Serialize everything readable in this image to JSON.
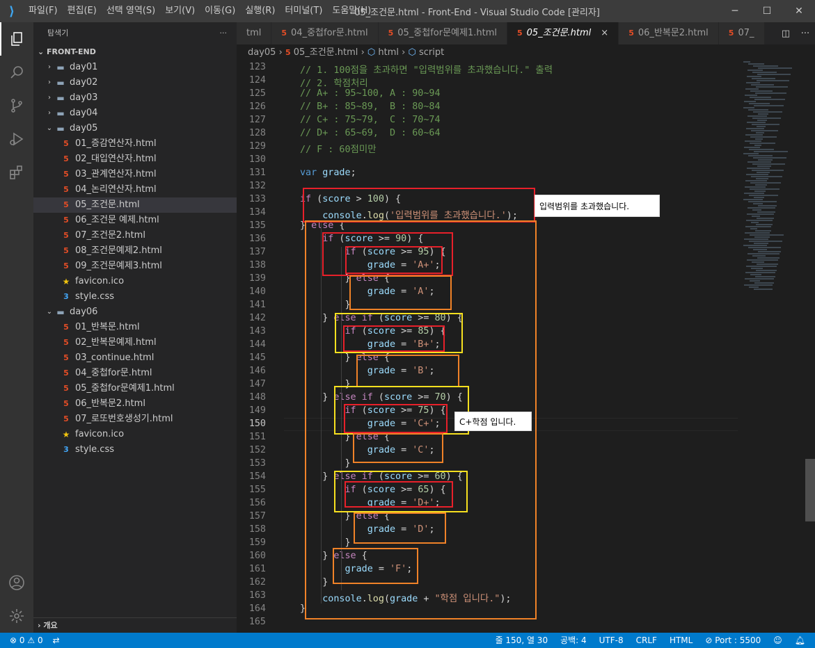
{
  "titlebar": {
    "menu": [
      "파일(F)",
      "편집(E)",
      "선택 영역(S)",
      "보기(V)",
      "이동(G)",
      "실행(R)",
      "터미널(T)",
      "도움말(H)"
    ],
    "title": "05_조건문.html - Front-End - Visual Studio Code [관리자]"
  },
  "sidebar": {
    "header": "탐색기",
    "more": "···",
    "section": "FRONT-END",
    "items": [
      {
        "label": "day01",
        "type": "folder",
        "depth": 1,
        "open": false
      },
      {
        "label": "day02",
        "type": "folder",
        "depth": 1,
        "open": false
      },
      {
        "label": "day03",
        "type": "folder",
        "depth": 1,
        "open": false
      },
      {
        "label": "day04",
        "type": "folder",
        "depth": 1,
        "open": false
      },
      {
        "label": "day05",
        "type": "folder",
        "depth": 1,
        "open": true
      },
      {
        "label": "01_증감연산자.html",
        "type": "html",
        "depth": 2
      },
      {
        "label": "02_대입연산자.html",
        "type": "html",
        "depth": 2
      },
      {
        "label": "03_관계연산자.html",
        "type": "html",
        "depth": 2
      },
      {
        "label": "04_논리연산자.html",
        "type": "html",
        "depth": 2
      },
      {
        "label": "05_조건문.html",
        "type": "html",
        "depth": 2,
        "selected": true
      },
      {
        "label": "06_조건문 예제.html",
        "type": "html",
        "depth": 2
      },
      {
        "label": "07_조건문2.html",
        "type": "html",
        "depth": 2
      },
      {
        "label": "08_조건문예제2.html",
        "type": "html",
        "depth": 2
      },
      {
        "label": "09_조건문예제3.html",
        "type": "html",
        "depth": 2
      },
      {
        "label": "favicon.ico",
        "type": "star",
        "depth": 2
      },
      {
        "label": "style.css",
        "type": "css",
        "depth": 2
      },
      {
        "label": "day06",
        "type": "folder",
        "depth": 1,
        "open": true
      },
      {
        "label": "01_반복문.html",
        "type": "html",
        "depth": 2
      },
      {
        "label": "02_반복문예제.html",
        "type": "html",
        "depth": 2
      },
      {
        "label": "03_continue.html",
        "type": "html",
        "depth": 2
      },
      {
        "label": "04_중첩for문.html",
        "type": "html",
        "depth": 2
      },
      {
        "label": "05_중첩for문예제1.html",
        "type": "html",
        "depth": 2
      },
      {
        "label": "06_반복문2.html",
        "type": "html",
        "depth": 2
      },
      {
        "label": "07_로또번호생성기.html",
        "type": "html",
        "depth": 2
      },
      {
        "label": "favicon.ico",
        "type": "star",
        "depth": 2
      },
      {
        "label": "style.css",
        "type": "css",
        "depth": 2
      }
    ],
    "outline": "개요"
  },
  "tabs": [
    {
      "label": "tml",
      "active": false
    },
    {
      "label": "04_중첩for문.html",
      "active": false
    },
    {
      "label": "05_중첩for문예제1.html",
      "active": false
    },
    {
      "label": "05_조건문.html",
      "active": true
    },
    {
      "label": "06_반복문2.html",
      "active": false
    },
    {
      "label": "07_",
      "active": false
    }
  ],
  "breadcrumb": {
    "parts": [
      "day05",
      "05_조건문.html",
      "html",
      "script"
    ]
  },
  "editor": {
    "line_numbers": [
      "123",
      "124",
      "125",
      "126",
      "127",
      "128",
      "129",
      "130",
      "131",
      "132",
      "133",
      "134",
      "135",
      "136",
      "137",
      "138",
      "139",
      "140",
      "141",
      "142",
      "143",
      "144",
      "145",
      "146",
      "147",
      "148",
      "149",
      "150",
      "151",
      "152",
      "153",
      "154",
      "155",
      "156",
      "157",
      "158",
      "159",
      "160",
      "161",
      "162",
      "163",
      "164",
      "165"
    ],
    "current_line": "150",
    "lines": [
      "// 1. 100점을 초과하면 \"입력범위를 초과했습니다.\" 출력",
      "// 2. 학점처리",
      "// A+ : 95~100, A : 90~94",
      "// B+ : 85~89,  B : 80~84",
      "// C+ : 75~79,  C : 70~74",
      "// D+ : 65~69,  D : 60~64",
      "// F : 60점미만",
      "",
      "var grade;",
      "",
      "if (score > 100) {",
      "    console.log('입력범위를 초과했습니다.');",
      "} else {",
      "    if (score >= 90) {",
      "        if (score >= 95) {",
      "            grade = 'A+';",
      "        } else {",
      "            grade = 'A';",
      "        }",
      "    } else if (score >= 80) {",
      "        if (score >= 85) {",
      "            grade = 'B+';",
      "        } else {",
      "            grade = 'B';",
      "        }",
      "    } else if (score >= 70) {",
      "        if (score >= 75) {",
      "            grade = 'C+';",
      "        } else {",
      "            grade = 'C';",
      "        }",
      "    } else if (score >= 60) {",
      "        if (score >= 65) {",
      "            grade = 'D+';",
      "        } else {",
      "            grade = 'D';",
      "        }",
      "    } else {",
      "        grade = 'F';",
      "    }",
      "    console.log(grade + \"학점 입니다.\");",
      "}",
      ""
    ],
    "tooltips": [
      "입력범위를 초과했습니다.",
      "C+학점 입니다."
    ]
  },
  "statusbar": {
    "errors": "0",
    "warnings": "0",
    "position": "줄 150, 열 30",
    "spaces": "공백: 4",
    "encoding": "UTF-8",
    "eol": "CRLF",
    "language": "HTML",
    "port": "Port : 5500"
  },
  "colors": {
    "accent": "#007acc",
    "red_box": "#e8202a",
    "orange_box": "#f08228",
    "yellow_box": "#f7e01f"
  }
}
